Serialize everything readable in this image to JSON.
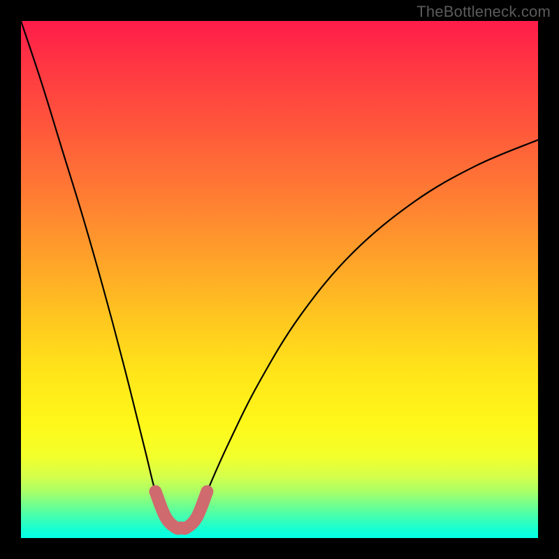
{
  "watermark": "TheBottleneck.com",
  "chart_data": {
    "type": "line",
    "title": "",
    "xlabel": "",
    "ylabel": "",
    "xlim": [
      0,
      100
    ],
    "ylim": [
      0,
      100
    ],
    "series": [
      {
        "name": "main-curve",
        "x": [
          0,
          4,
          8,
          12,
          16,
          20,
          24,
          26,
          28,
          30,
          31,
          32,
          34,
          36,
          40,
          46,
          54,
          64,
          76,
          88,
          100
        ],
        "values": [
          100,
          88,
          75,
          62,
          48,
          33,
          17,
          9,
          4,
          2,
          2,
          2,
          4,
          9,
          18,
          30,
          43,
          55,
          65,
          72,
          77
        ]
      },
      {
        "name": "highlight-segment",
        "x": [
          26,
          28,
          30,
          31,
          32,
          34,
          36
        ],
        "values": [
          9,
          4,
          2,
          2,
          2,
          4,
          9
        ]
      }
    ],
    "highlight_color": "#cf6a6f",
    "gradient_stops": [
      {
        "pos": 0.0,
        "color": "#ff1c4a"
      },
      {
        "pos": 0.5,
        "color": "#ffc81f"
      },
      {
        "pos": 0.8,
        "color": "#fff81a"
      },
      {
        "pos": 1.0,
        "color": "#05ffe8"
      }
    ]
  }
}
